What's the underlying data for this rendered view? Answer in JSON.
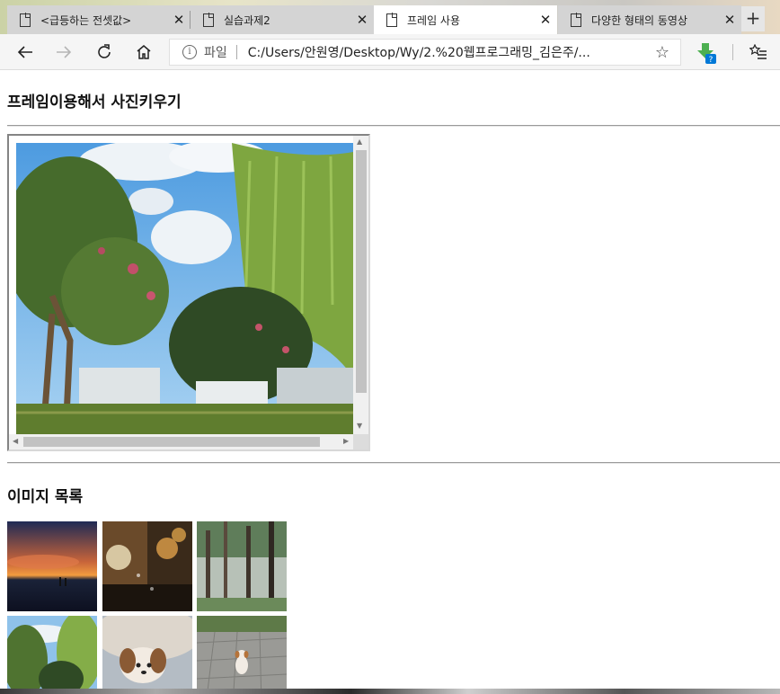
{
  "tabs": [
    {
      "title": "<급등하는 전셋값>",
      "active": false
    },
    {
      "title": "실습과제2",
      "active": false
    },
    {
      "title": "프레임 사용",
      "active": true
    },
    {
      "title": "다양한 형태의 동영상",
      "active": false
    }
  ],
  "toolbar": {
    "address_scheme": "파일",
    "address_url": "C:/Users/안원영/Desktop/Wy/2.%20웹프로그래밍_김은주/...",
    "extension_badge": "?"
  },
  "page": {
    "heading_frame": "프레임이용해서 사진키우기",
    "heading_list": "이미지 목록"
  },
  "thumbnails": [
    {
      "subject": "sunset-sea"
    },
    {
      "subject": "rainy-window-lights"
    },
    {
      "subject": "misty-forest"
    },
    {
      "subject": "park-trees"
    },
    {
      "subject": "puppy-blanket"
    },
    {
      "subject": "puppy-pavement"
    }
  ],
  "colors": {
    "accent": "#0078d7",
    "ext_green": "#4caf50"
  }
}
